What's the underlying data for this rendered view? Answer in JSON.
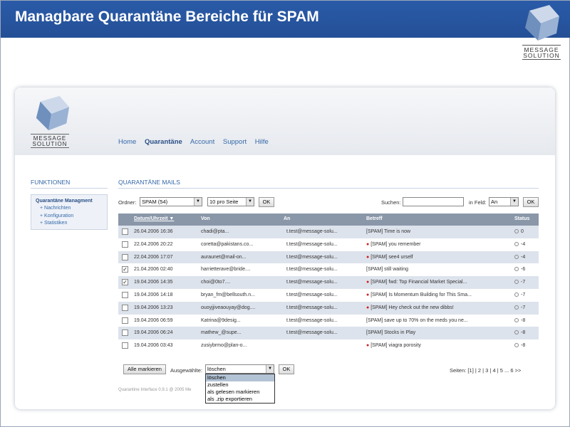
{
  "slide": {
    "title": "Managbare Quarantäne Bereiche für SPAM",
    "logo_line1": "MESSAGE",
    "logo_line2": "SOLUTION"
  },
  "app": {
    "logo_line1": "MESSAGE",
    "logo_line2": "SOLUTION",
    "nav": [
      "Home",
      "Quarantäne",
      "Account",
      "Support",
      "Hilfe"
    ],
    "active_nav": "Quarantäne"
  },
  "sidebar": {
    "heading": "FUNKTIONEN",
    "main_item": "Quarantäne Managment",
    "items": [
      "Nachrichten",
      "Konfiguration",
      "Statistiken"
    ]
  },
  "main": {
    "heading": "QUARANTÄNE MAILS",
    "folder_label": "Ordner:",
    "folder_value": "SPAM (54)",
    "per_page_value": "10 pro Seite",
    "ok_label": "OK",
    "search_label": "Suchen:",
    "search_value": "",
    "field_label": "in Feld:",
    "field_value": "An"
  },
  "table": {
    "columns": [
      "Datum/Uhrzeit ▼",
      "Von",
      "An",
      "Betreff",
      "Status"
    ],
    "rows": [
      {
        "checked": false,
        "date": "26.04.2006 16:36",
        "from": "chadi@pta...",
        "to": "t.test@message-solu...",
        "flag": false,
        "subject": "[SPAM] Time is now",
        "status": "0"
      },
      {
        "checked": false,
        "date": "22.04.2006 20:22",
        "from": "coretta@pakistans.co...",
        "to": "t.test@message-solu...",
        "flag": true,
        "subject": "[SPAM] you remember",
        "status": "-4"
      },
      {
        "checked": false,
        "date": "22.04.2006 17:07",
        "from": "auraunet@mail-on...",
        "to": "t.test@message-solu...",
        "flag": true,
        "subject": "[SPAM] see4 urself",
        "status": "-4"
      },
      {
        "checked": true,
        "date": "21.04.2006 02:40",
        "from": "harrietterave@bride....",
        "to": "t.test@message-solu...",
        "flag": false,
        "subject": "[SPAM] still waiting",
        "status": "-6"
      },
      {
        "checked": true,
        "date": "19.04.2006 14:35",
        "from": "choi@0to7....",
        "to": "t.test@message-solu...",
        "flag": true,
        "subject": "[SPAM] fwd: Top Financial Market Special...",
        "status": "-7"
      },
      {
        "checked": false,
        "date": "19.04.2006 14:18",
        "from": "bryan_fm@bellsouth.n...",
        "to": "t.test@message-solu...",
        "flag": true,
        "subject": "[SPAM] Is Momentum Building for This Sma...",
        "status": "-7"
      },
      {
        "checked": false,
        "date": "19.04.2006 13:23",
        "from": "ouoyjjiveaouyay@dog....",
        "to": "t.test@message-solu...",
        "flag": true,
        "subject": "[SPAM] Hey check out the new dibbs!",
        "status": "-7"
      },
      {
        "checked": false,
        "date": "19.04.2006 06:59",
        "from": "Katrina@9desig...",
        "to": "t.test@message-solu...",
        "flag": false,
        "subject": "[SPAM] save up to 70% on the meds you ne...",
        "status": "-8"
      },
      {
        "checked": false,
        "date": "19.04.2006 06:24",
        "from": "mathew_@supe...",
        "to": "t.test@message-solu...",
        "flag": false,
        "subject": "[SPAM] Stocks in Play",
        "status": "-8"
      },
      {
        "checked": false,
        "date": "19.04.2006 03:43",
        "from": "zusiybrmo@plan-o...",
        "to": "",
        "flag": true,
        "subject": "[SPAM] viagra porosity",
        "status": "-8"
      }
    ]
  },
  "bottom": {
    "mark_all_label": "Alle markieren",
    "selected_label": "Ausgewählte:",
    "action_value": "löschen",
    "ok_label": "OK",
    "pager_text": "Seiten:  [1] | 2 | 3 | 4 | 5 ... 6  >>",
    "action_options": [
      "löschen",
      "zustellen",
      "als gelesen markieren",
      "als .zip exportieren"
    ],
    "footer_text": "Quarantine Interface 0.9.1 @ 2005 Me"
  },
  "colors": {
    "title_bar": "#2a5ba8",
    "table_header": "#8a97a9",
    "row_alt": "#dde3ec",
    "link": "#3568a8",
    "flag": "#d42020"
  }
}
